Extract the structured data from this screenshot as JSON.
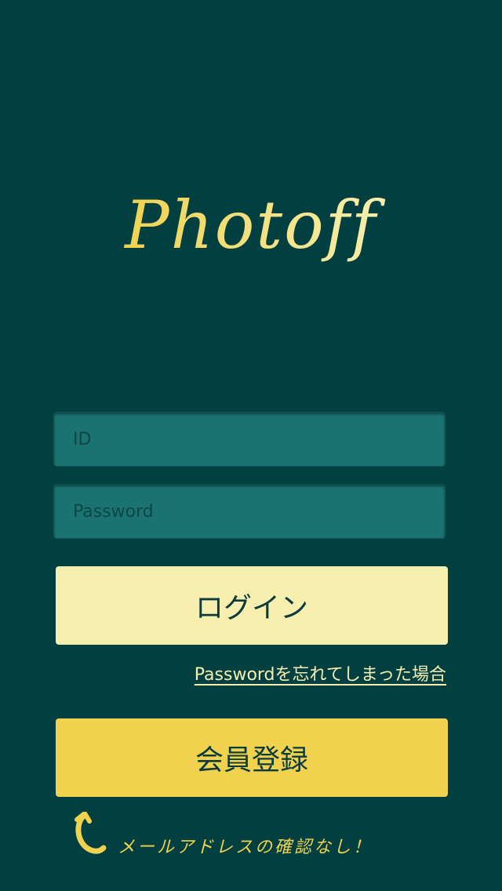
{
  "app": {
    "logo_text": "Photoff"
  },
  "login_form": {
    "id_placeholder": "ID",
    "password_placeholder": "Password",
    "login_label": "ログイン",
    "forgot_password_label": "Passwordを忘れてしまった場合",
    "register_label": "会員登録",
    "note_text": "メールアドレスの確認なし！"
  },
  "colors": {
    "background": "#023f41",
    "input_fill": "#1a7371",
    "login_button": "#f7efaf",
    "register_button": "#f0d24f",
    "logo_yellow": "#f0d24f",
    "logo_cream": "#f7efaf"
  },
  "icons": {
    "note_arrow": "curved-arrow-icon"
  }
}
